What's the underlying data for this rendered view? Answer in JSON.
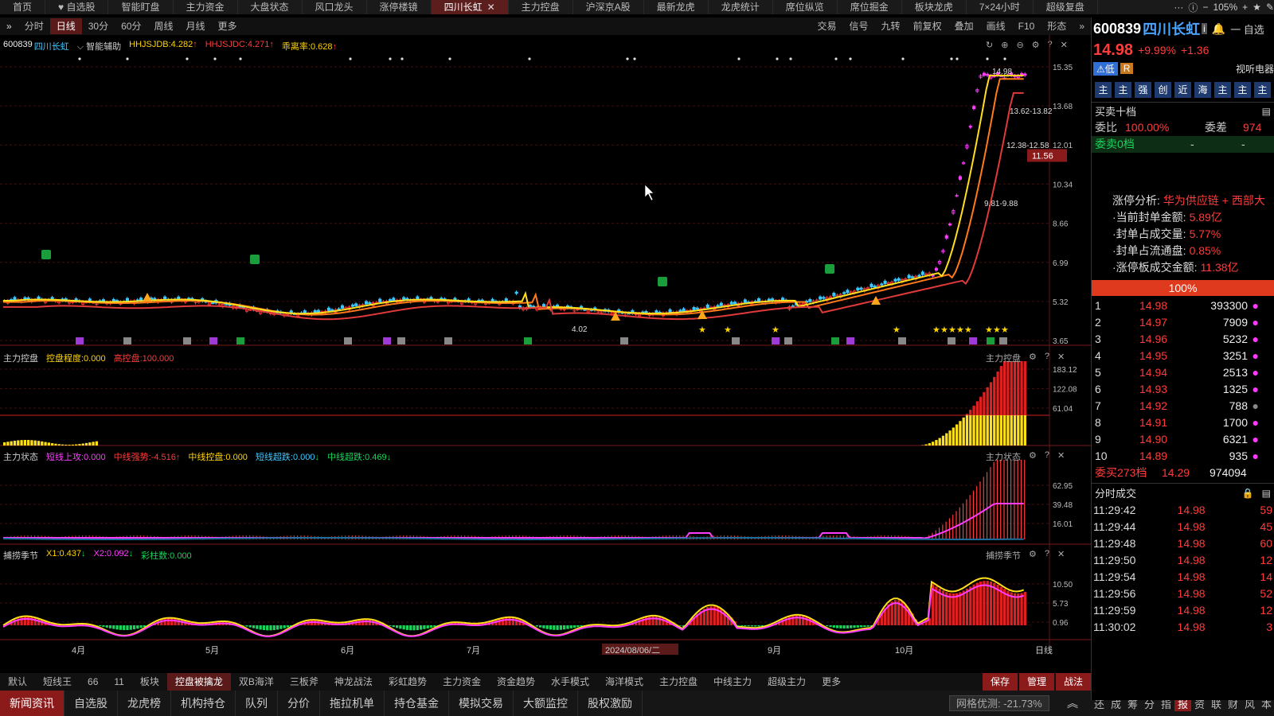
{
  "topbar": {
    "tabs": [
      "首页",
      "♥ 自选股",
      "智能盯盘",
      "主力资金",
      "大盘状态",
      "风口龙头",
      "涨停楼镜",
      "四川长虹",
      "主力控盘",
      "沪深京A股",
      "最新龙虎",
      "龙虎统计",
      "席位纵览",
      "席位掘金",
      "板块龙虎",
      "7×24小时",
      "超级复盘"
    ],
    "active_tab": "四川长虹",
    "zoom": "105%"
  },
  "toolbar": {
    "periods": [
      "分时",
      "日线",
      "30分",
      "60分",
      "周线",
      "月线",
      "更多"
    ],
    "active_period": "日线",
    "right_items": [
      "交易",
      "信号",
      "九转",
      "前复权",
      "叠加",
      "画线",
      "F10",
      "形态"
    ]
  },
  "main_chart": {
    "code": "600839",
    "name": "四川长虹",
    "assist": "智能辅助",
    "ind1": "HHJSJDB:4.282",
    "ind2": "HHJSJDC:4.271",
    "ind3": "乖离率:0.628",
    "y_ticks": [
      "15.35",
      "13.68",
      "12.01",
      "10.34",
      "8.66",
      "6.99",
      "5.32",
      "3.65"
    ],
    "current_price_tag": "11.56",
    "annotations": [
      "14.98",
      "13.62-13.82",
      "12.38-12.58",
      "9.81-9.88",
      "4.02"
    ]
  },
  "panel2": {
    "title": "主力控盘",
    "p1": "控盘程度:0.000",
    "p2": "高控盘:100.000",
    "right_title": "主力控盘",
    "y_ticks": [
      "183.12",
      "122.08",
      "61.04"
    ]
  },
  "panel3": {
    "title": "主力状态",
    "p1": "短线上攻:0.000",
    "p2": "中线强势:-4.516",
    "p3": "中线控盘:0.000",
    "p4": "短线超跌:0.000",
    "p5": "中线超跌:0.469",
    "right_title": "主力状态",
    "y_ticks": [
      "62.95",
      "39.48",
      "16.01"
    ]
  },
  "panel4": {
    "title": "捕捞季节",
    "p1": "X1:0.437",
    "p2": "X2:0.092",
    "p3": "彩柱数:0.000",
    "right_title": "捕捞季节",
    "y_ticks": [
      "10.50",
      "5.73",
      "0.96"
    ]
  },
  "x_axis": {
    "labels": [
      "4月",
      "5月",
      "6月",
      "7月",
      "2024/08/06/二",
      "9月",
      "10月"
    ],
    "right": "日线"
  },
  "bottom_tabs": {
    "tabs": [
      "默认",
      "短线王",
      "66",
      "11",
      "板块",
      "控盘被擒龙",
      "双B海洋",
      "三板斧",
      "神龙战法",
      "彩虹趋势",
      "主力资金",
      "资金趋势",
      "水手模式",
      "海洋模式",
      "主力控盘",
      "中线主力",
      "超级主力",
      "更多"
    ],
    "active": "控盘被擒龙",
    "right": [
      "保存",
      "管理",
      "战法"
    ]
  },
  "status": {
    "tabs": [
      "新闻资讯",
      "自选股",
      "龙虎榜",
      "机构持仓",
      "队列",
      "分价",
      "拖拉机单",
      "持仓基金",
      "模拟交易",
      "大额监控",
      "股权激励"
    ],
    "active": "新闻资讯",
    "grid": "网格优测: -21.73%",
    "right_icons": [
      "还",
      "成",
      "筹",
      "分",
      "指",
      "报",
      "资",
      "联",
      "财",
      "风",
      "本"
    ]
  },
  "right": {
    "code": "600839",
    "name": "四川长虹",
    "price": "14.98",
    "change_pct": "+9.99%",
    "change": "+1.36",
    "badge1": "低",
    "badge2": "R",
    "concept": "视听电器",
    "buttons": [
      "主",
      "主",
      "强",
      "创",
      "近",
      "海",
      "主",
      "主",
      "主"
    ],
    "section": "买卖十档",
    "weibi_label": "委比",
    "weibi": "100.00%",
    "weicha_label": "委差",
    "weicha": "974",
    "sell0": "委卖0档",
    "dash1": "-",
    "dash2": "-",
    "analysis": [
      {
        "k": "涨停分析:",
        "v": "华为供应链 + 西部大"
      },
      {
        "k": "·当前封单金额:",
        "v": "5.89亿"
      },
      {
        "k": "·封单占成交量:",
        "v": "5.77%"
      },
      {
        "k": "·封单占流通盘:",
        "v": "0.85%"
      },
      {
        "k": "·涨停板成交金额:",
        "v": "11.38亿"
      }
    ],
    "pct_bar": "100%",
    "bids": [
      {
        "n": "1",
        "p": "14.98",
        "v": "393300"
      },
      {
        "n": "2",
        "p": "14.97",
        "v": "7909"
      },
      {
        "n": "3",
        "p": "14.96",
        "v": "5232"
      },
      {
        "n": "4",
        "p": "14.95",
        "v": "3251"
      },
      {
        "n": "5",
        "p": "14.94",
        "v": "2513"
      },
      {
        "n": "6",
        "p": "14.93",
        "v": "1325"
      },
      {
        "n": "7",
        "p": "14.92",
        "v": "788"
      },
      {
        "n": "8",
        "p": "14.91",
        "v": "1700"
      },
      {
        "n": "9",
        "p": "14.90",
        "v": "6321"
      },
      {
        "n": "10",
        "p": "14.89",
        "v": "935"
      }
    ],
    "buy_total_label": "委买273档",
    "buy_total_p": "14.29",
    "buy_total_v": "974094",
    "ticks_title": "分时成交",
    "ticks": [
      {
        "t": "11:29:42",
        "p": "14.98",
        "v": "59"
      },
      {
        "t": "11:29:44",
        "p": "14.98",
        "v": "45"
      },
      {
        "t": "11:29:48",
        "p": "14.98",
        "v": "60"
      },
      {
        "t": "11:29:50",
        "p": "14.98",
        "v": "12"
      },
      {
        "t": "11:29:54",
        "p": "14.98",
        "v": "14"
      },
      {
        "t": "11:29:56",
        "p": "14.98",
        "v": "52"
      },
      {
        "t": "11:29:59",
        "p": "14.98",
        "v": "12"
      },
      {
        "t": "11:30:02",
        "p": "14.98",
        "v": "3"
      }
    ]
  }
}
